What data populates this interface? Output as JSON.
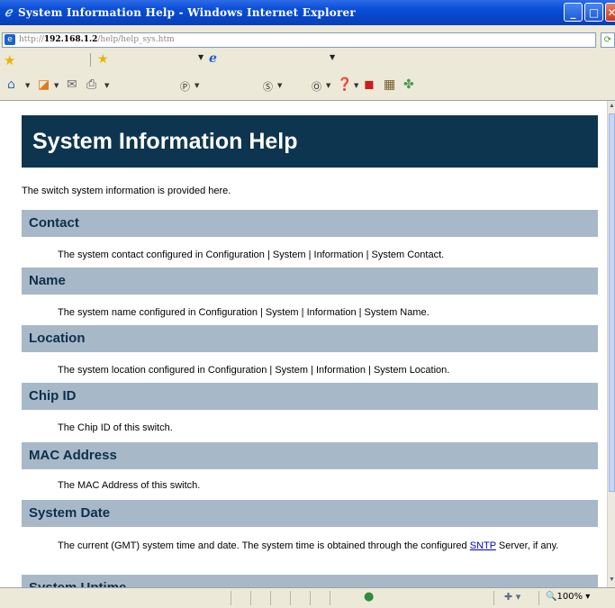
{
  "window": {
    "title": "System Information Help - Windows Internet Explorer",
    "min_label": "_",
    "max_label": "□",
    "close_label": "✕"
  },
  "address": {
    "url_prefix": "http://",
    "url_host": "192.168.1.2",
    "url_path": "/help/help_sys.htm"
  },
  "statusbar": {
    "zoom": "100%"
  },
  "page": {
    "title": "System Information Help",
    "intro": "The switch system information is provided here.",
    "sections": [
      {
        "heading": "Contact",
        "desc": "The system contact configured in Configuration | System | Information | System Contact."
      },
      {
        "heading": "Name",
        "desc": "The system name configured in Configuration | System | Information | System Name."
      },
      {
        "heading": "Location",
        "desc": "The system location configured in Configuration | System | Information | System Location."
      },
      {
        "heading": "Chip ID",
        "desc": "The Chip ID of this switch."
      },
      {
        "heading": "MAC Address",
        "desc": "The MAC Address of this switch."
      },
      {
        "heading": "System Date",
        "desc_pre": "The current (GMT) system time and date. The system time is obtained through the configured ",
        "desc_link": "SNTP",
        "desc_post": " Server, if any."
      },
      {
        "heading": "System Uptime"
      }
    ]
  },
  "icons": {
    "title_icon": "ie-logo-icon",
    "favorites": "favorites-star-icon",
    "add_favorites": "add-favorites-icon",
    "home": "home-icon",
    "feeds": "feeds-icon",
    "mail": "mail-icon",
    "print": "print-icon",
    "help": "help-icon",
    "status_zone": "internet-zone-icon"
  }
}
